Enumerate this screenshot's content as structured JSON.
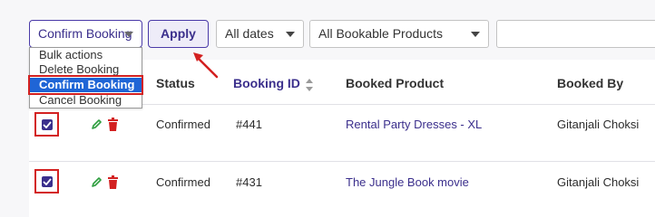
{
  "toolbar": {
    "bulk_actions_selected": "Confirm Booking",
    "apply_label": "Apply",
    "dates_filter": "All dates",
    "products_filter": "All Bookable Products"
  },
  "bulk_menu": {
    "options": [
      "Bulk actions",
      "Delete Booking",
      "Confirm Booking",
      "Cancel Booking"
    ],
    "selected": "Confirm Booking"
  },
  "table": {
    "headers": [
      "Status",
      "Booking ID",
      "Booked Product",
      "Booked By"
    ],
    "rows": [
      {
        "status": "Confirmed",
        "booking_id": "#441",
        "product": "Rental Party Dresses - XL",
        "booked_by": "Gitanjali Choksi",
        "checked": true
      },
      {
        "status": "Confirmed",
        "booking_id": "#431",
        "product": "The Jungle Book movie",
        "booked_by": "Gitanjali Choksi",
        "checked": true
      }
    ]
  },
  "colors": {
    "accent": "#3b2f8c",
    "highlight": "#d32020",
    "selected_option": "#1f65d6",
    "edit_icon": "#2e9e3f",
    "delete_icon": "#d32020"
  }
}
